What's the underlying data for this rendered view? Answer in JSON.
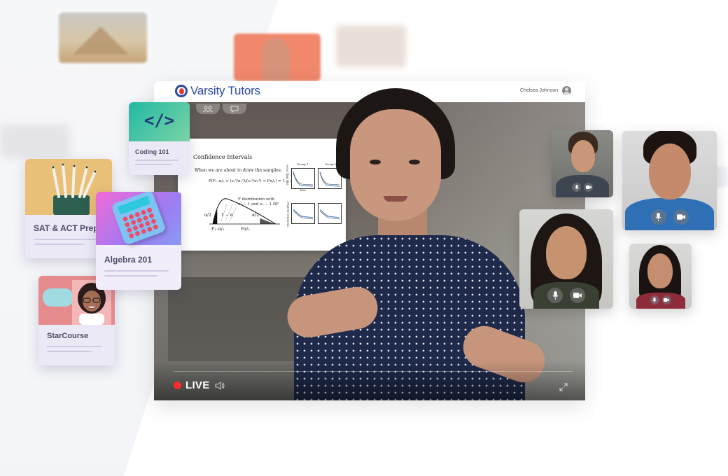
{
  "app": {
    "brand": "Varsity Tutors",
    "user_name": "Chelsea Johnson"
  },
  "toolbar": {
    "tabs": [
      {
        "name": "participants",
        "icon": "people-icon"
      },
      {
        "name": "chat",
        "icon": "chat-bubble-icon"
      }
    ]
  },
  "slide": {
    "title": "Confidence Intervals",
    "subtitle": "When we are about to draw the samples:",
    "equation": "P(F₁₋α/₂ < (s₁²/σ₁²)/(s₂²/σ₂²) < Fα/₂) = 1 − α",
    "dist_label_1": "F distribution with",
    "dist_label_2": "ν₁ − 1 and ν₂ − 1 DF",
    "label_left": "α/2",
    "label_mid": "1 − α",
    "label_right": "α/2",
    "label_f1": "F₁₋α/₂",
    "label_f2": "Fα/₂",
    "plot_headers": [
      "Group 1",
      "Group 2"
    ],
    "plot_ylabels": [
      "Sqft_Bldg_Gross",
      "Prediction_Residual"
    ],
    "plot_xlabel": "Time"
  },
  "player": {
    "live_label": "LIVE",
    "live_color": "#ff2a2a",
    "icons": [
      "speaker-icon",
      "expand-icon"
    ]
  },
  "courses": [
    {
      "title": "Coding 101",
      "thumb": "</>"
    },
    {
      "title": "SAT & ACT Prep"
    },
    {
      "title": "Algebra 201"
    },
    {
      "title": "StarCourse"
    }
  ],
  "participants": {
    "controls": [
      "microphone-icon",
      "camera-icon"
    ]
  },
  "colors": {
    "brand": "#2b4aa3",
    "card_bg": "#ece9f7",
    "card_text": "#4c4a66"
  }
}
